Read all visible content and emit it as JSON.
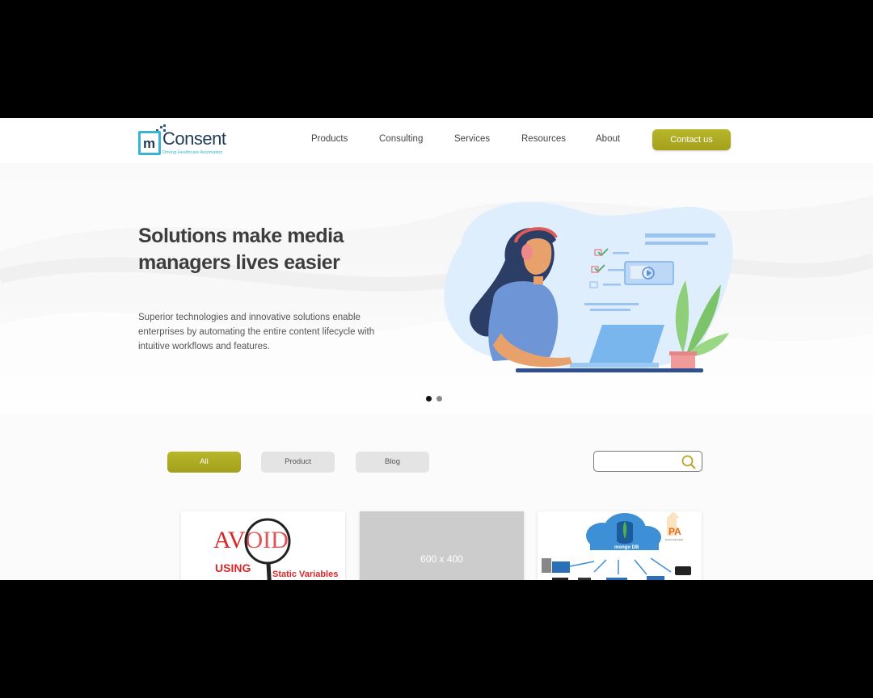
{
  "brand": {
    "name": "Consent",
    "mark_letter": "m",
    "tagline": "Driving Healthcare Automation"
  },
  "nav": {
    "items": [
      "Products",
      "Consulting",
      "Services",
      "Resources",
      "About"
    ],
    "contact_label": "Contact us"
  },
  "hero": {
    "title": "Solutions make media managers lives easier",
    "description": "Superior technologies and innovative solutions enable enterprises by automating the entire content lifecycle with intuitive workflows and features.",
    "slides": 2,
    "active_slide": 1
  },
  "filters": {
    "buttons": [
      "All",
      "Product",
      "Blog"
    ],
    "active": "All",
    "search_value": "",
    "search_placeholder": ""
  },
  "cards": [
    {
      "type": "image",
      "image_text": {
        "avoid": "AVOID",
        "using": "USING",
        "subtitle": "Static Variables"
      }
    },
    {
      "type": "placeholder",
      "placeholder_text": "600 x 400"
    },
    {
      "type": "image",
      "image_text": {
        "db": "mongo DB",
        "badge": "PA",
        "badge_sub": "Process Automation"
      }
    }
  ],
  "colors": {
    "accent": "#ADAB22",
    "brand_blue": "#3AB4D6",
    "brand_navy": "#1F3B57",
    "active_dot": "#111111",
    "inactive_dot": "#8a8a8a"
  }
}
